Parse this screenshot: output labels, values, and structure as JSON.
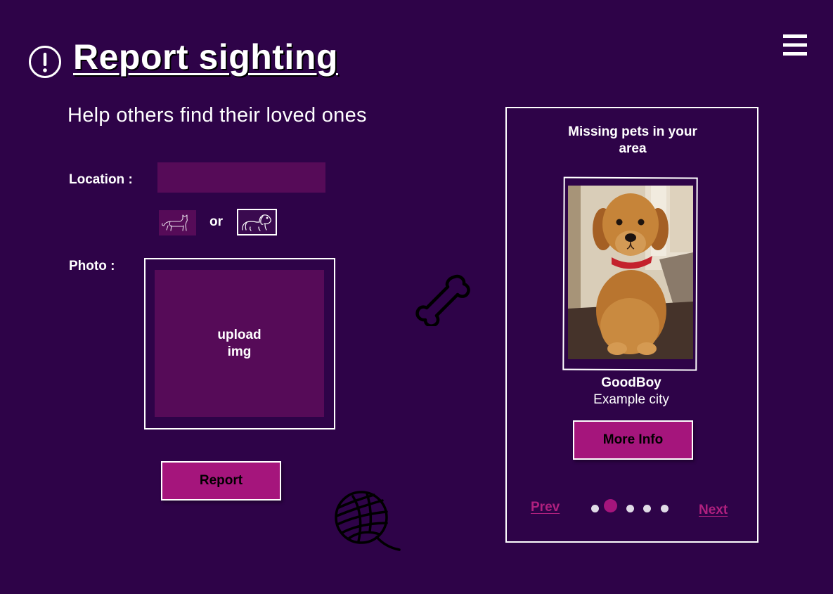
{
  "header": {
    "title": "Report sighting",
    "subtitle": "Help others find their loved ones",
    "alert_icon": "exclamation-circle-icon",
    "menu_icon": "hamburger-menu-icon"
  },
  "form": {
    "location_label": "Location :",
    "location_value": "",
    "pet_type": {
      "options": [
        "cat",
        "dog"
      ],
      "separator": "or",
      "selected": "dog"
    },
    "photo_label": "Photo :",
    "upload_text": "upload\nimg",
    "report_label": "Report"
  },
  "decorations": {
    "bone_icon": "bone-icon",
    "yarn_icon": "yarn-ball-icon"
  },
  "missing_panel": {
    "title": "Missing pets in your area",
    "pet": {
      "name": "GoodBoy",
      "city": "Example city"
    },
    "more_info_label": "More Info",
    "prev_label": "Prev",
    "next_label": "Next",
    "pagination": {
      "total": 5,
      "current": 2
    }
  },
  "colors": {
    "background": "#2e0348",
    "input_fill": "#560b58",
    "accent": "#a5157c",
    "link": "#b0207f",
    "border": "#ffffff"
  }
}
